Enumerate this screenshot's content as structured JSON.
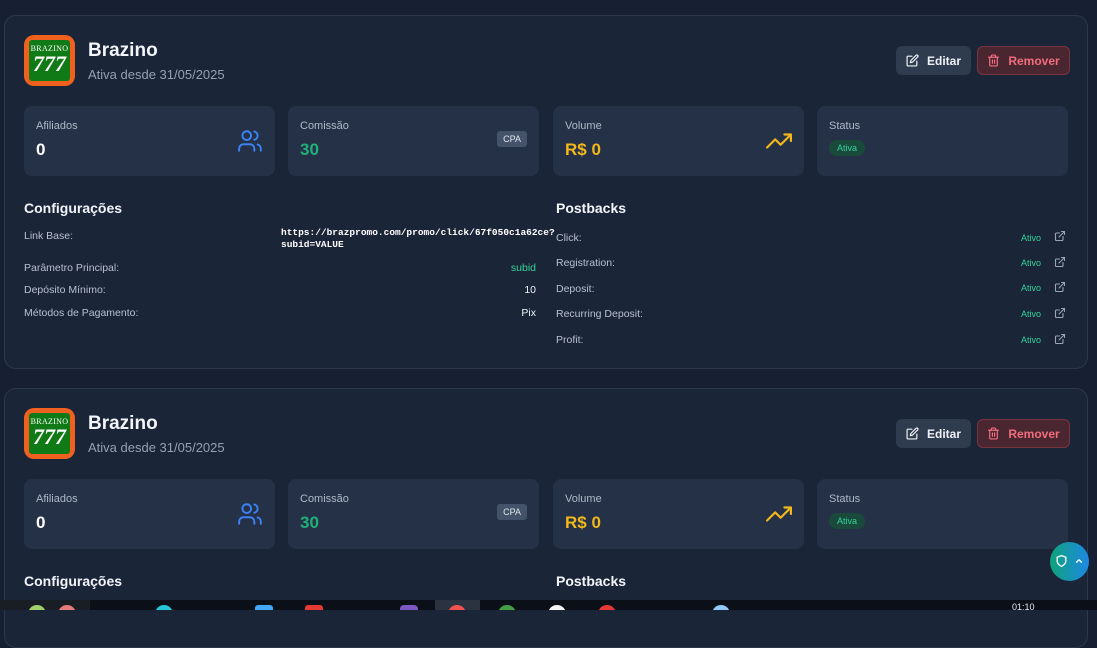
{
  "cards": [
    {
      "logo_text_top": "BRAZINO",
      "logo_text_num": "777",
      "title": "Brazino",
      "subtitle": "Ativa desde 31/05/2025",
      "edit_label": "Editar",
      "remove_label": "Remover",
      "stats": {
        "affiliates": {
          "label": "Afiliados",
          "value": "0",
          "icon": "users-icon"
        },
        "commission": {
          "label": "Comissão",
          "value": "30",
          "tag": "CPA"
        },
        "volume": {
          "label": "Volume",
          "value": "R$ 0",
          "icon": "trending-up-icon"
        },
        "status": {
          "label": "Status",
          "value": "Ativa"
        }
      },
      "config": {
        "title": "Configurações",
        "link_base_label": "Link Base:",
        "link_base_value_line1": "https://brazpromo.com/promo/click/67f050c1a62ce?",
        "link_base_value_line2": "subid=VALUE",
        "param_label": "Parâmetro Principal:",
        "param_value": "subid",
        "deposit_label": "Depósito Mínimo:",
        "deposit_value": "10",
        "methods_label": "Métodos de Pagamento:",
        "methods_value": "Pix"
      },
      "postbacks": {
        "title": "Postbacks",
        "items": [
          {
            "label": "Click:",
            "status": "Ativo"
          },
          {
            "label": "Registration:",
            "status": "Ativo"
          },
          {
            "label": "Deposit:",
            "status": "Ativo"
          },
          {
            "label": "Recurring Deposit:",
            "status": "Ativo"
          },
          {
            "label": "Profit:",
            "status": "Ativo"
          }
        ]
      }
    },
    {
      "logo_text_top": "BRAZINO",
      "logo_text_num": "777",
      "title": "Brazino",
      "subtitle": "Ativa desde 31/05/2025",
      "edit_label": "Editar",
      "remove_label": "Remover",
      "stats": {
        "affiliates": {
          "label": "Afiliados",
          "value": "0",
          "icon": "users-icon"
        },
        "commission": {
          "label": "Comissão",
          "value": "30",
          "tag": "CPA"
        },
        "volume": {
          "label": "Volume",
          "value": "R$ 0",
          "icon": "trending-up-icon"
        },
        "status": {
          "label": "Status",
          "value": "Ativa"
        }
      },
      "config": {
        "title": "Configurações"
      },
      "postbacks": {
        "title": "Postbacks"
      }
    }
  ],
  "taskbar": {
    "time": "01:10"
  },
  "colors": {
    "background": "#162032",
    "card": "#1b2538",
    "stat_card": "#253146",
    "green": "#21b07a",
    "yellow": "#f2b81b",
    "blue_icon": "#3b82f6",
    "danger": "#f26d7d"
  }
}
